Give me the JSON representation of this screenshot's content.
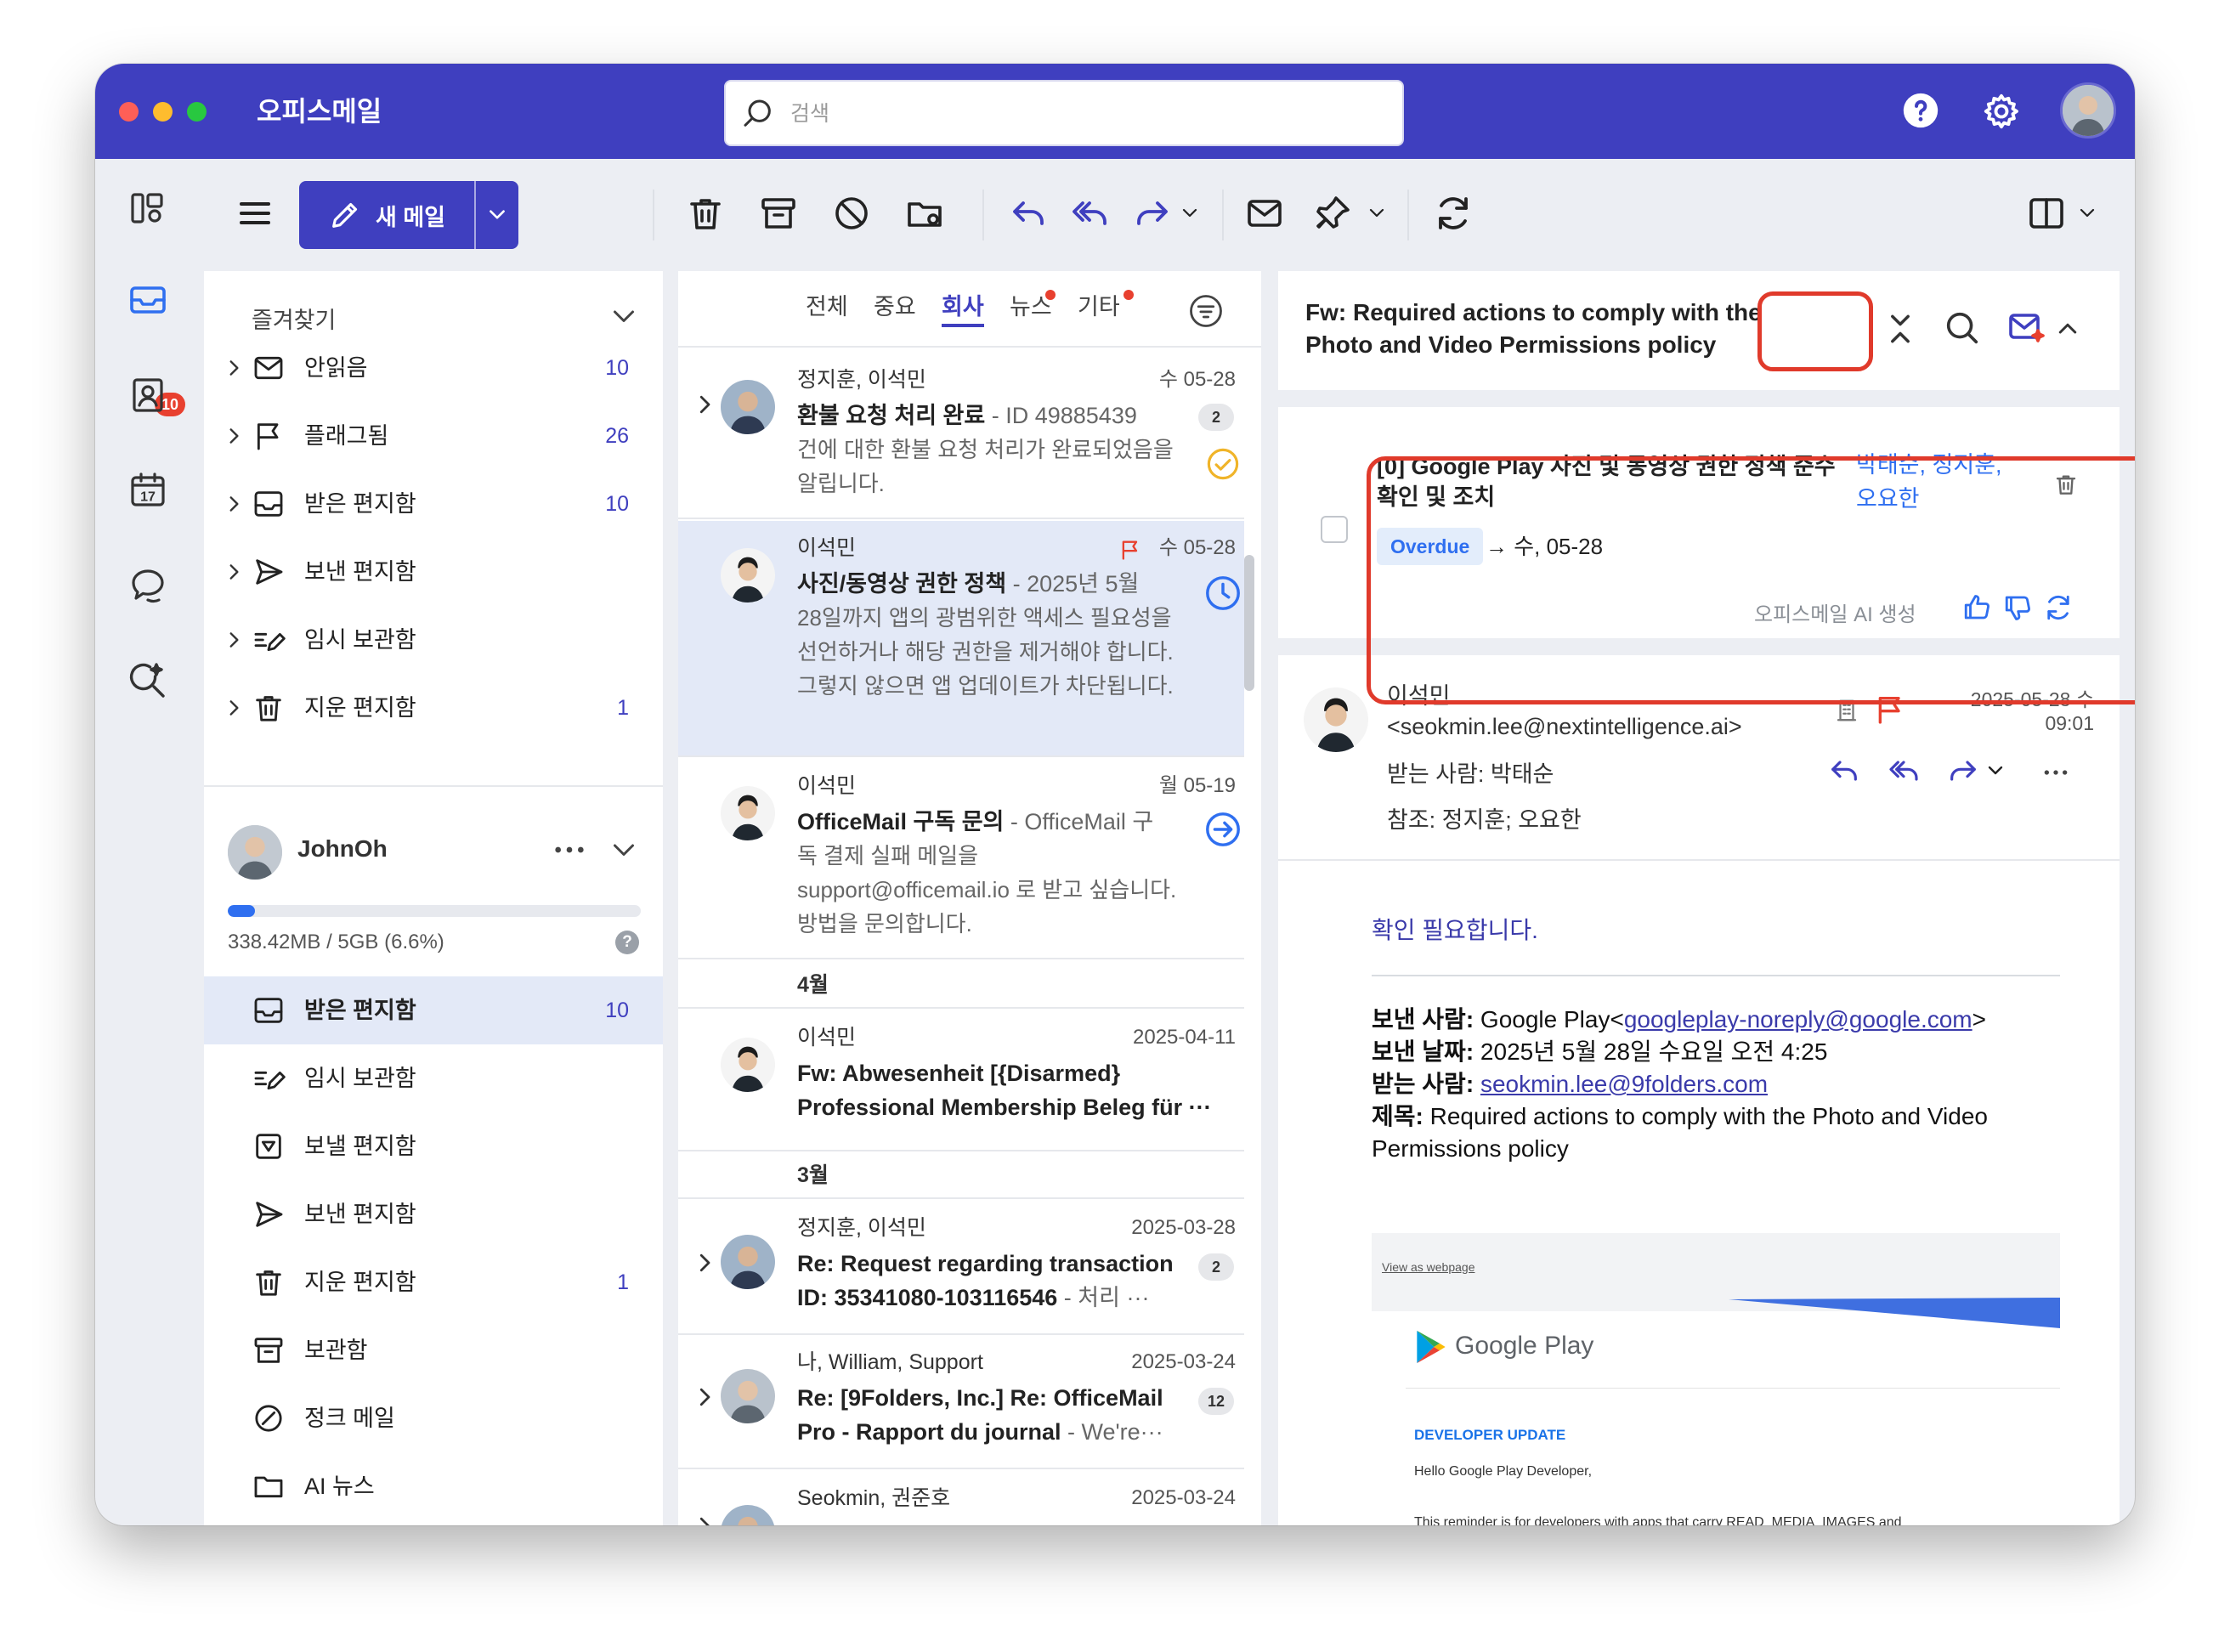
{
  "window": {
    "title": "오피스메일"
  },
  "search": {
    "placeholder": "검색"
  },
  "rail": {
    "mail_badge": "10"
  },
  "toolbar": {
    "new_mail_label": "새 메일"
  },
  "favorites": {
    "title": "즐겨찾기",
    "items": [
      {
        "label": "안읽음",
        "count": "10"
      },
      {
        "label": "플래그됨",
        "count": "26"
      },
      {
        "label": "받은 편지함",
        "count": "10"
      },
      {
        "label": "보낸 편지함",
        "count": ""
      },
      {
        "label": "임시 보관함",
        "count": ""
      },
      {
        "label": "지운 편지함",
        "count": "1"
      }
    ]
  },
  "account": {
    "name": "JohnOh",
    "storage_text": "338.42MB / 5GB (6.6%)",
    "storage_fraction": 0.066,
    "help": "?",
    "folders": [
      {
        "label": "받은 편지함",
        "count": "10"
      },
      {
        "label": "임시 보관함",
        "count": ""
      },
      {
        "label": "보낼 편지함",
        "count": ""
      },
      {
        "label": "보낸 편지함",
        "count": ""
      },
      {
        "label": "지운 편지함",
        "count": "1"
      },
      {
        "label": "보관함",
        "count": ""
      },
      {
        "label": "정크 메일",
        "count": ""
      },
      {
        "label": "AI 뉴스",
        "count": ""
      }
    ]
  },
  "filter_tabs": [
    "전체",
    "중요",
    "회사",
    "뉴스",
    "기타"
  ],
  "messages": [
    {
      "sender": "정지훈, 이석민",
      "date": "수 05-28",
      "subject": "환불 요청 처리 완료",
      "preview_inline": " - ID 49885439",
      "preview": "건에 대한 환불 요청 처리가 완료되었음을 알립니다.",
      "count": "2"
    },
    {
      "sender": "이석민",
      "date": "수 05-28",
      "subject": "사진/동영상 권한 정책",
      "preview_inline": " - 2025년 5월",
      "preview": "28일까지 앱의 광범위한 액세스 필요성을 선언하거나 해당 권한을 제거해야 합니다. 그렇지 않으면 앱 업데이트가 차단됩니다."
    },
    {
      "sender": "이석민",
      "date": "월 05-19",
      "subject": "OfficeMail 구독 문의",
      "preview_inline": " - OfficeMail 구",
      "preview": "독 결제 실패 메일을 support@officemail.io 로 받고 싶습니다. 방법을 문의합니다."
    },
    {
      "sender": "이석민",
      "date": "2025-04-11",
      "subject": "Fw: Abwesenheit [{Disarmed} Professional Membership Beleg für ···"
    },
    {
      "sender": "정지훈, 이석민",
      "date": "2025-03-28",
      "subject": "Re: Request regarding transaction ID: 35341080-103116546",
      "preview_inline": " - 처리 ···",
      "count": "2"
    },
    {
      "sender": "나, William, Support",
      "date": "2025-03-24",
      "subject": "Re: [9Folders, Inc.] Re: OfficeMail Pro - Rapport du journal",
      "preview_inline": " - We're···",
      "count": "12"
    },
    {
      "sender": "Seokmin, 권준호",
      "date": "2025-03-24"
    }
  ],
  "groups": {
    "april": "4월",
    "march": "3월"
  },
  "reader": {
    "subject": "Fw: Required actions to comply with the Photo and Video Permissions policy",
    "ai_task": "[0] Google Play 사진 및 동영상 권한 정책 준수 확인 및 조치",
    "ai_people": "박태순, 정지훈, 오요한",
    "overdue": "Overdue",
    "due": "→ 수, 05-28",
    "ai_generated": "오피스메일 AI 생성",
    "from_name": "이석민",
    "from_email": "<seokmin.lee@nextintelligence.ai>",
    "date_line1": "2025-05-28 수",
    "date_line2": "09:01",
    "to": "받는 사람: 박태순",
    "cc": "참조: 정지훈;  오요한",
    "greeting": "확인 필요합니다.",
    "fwd_from_label": "보낸 사람:",
    "fwd_from_text": " Google Play<",
    "fwd_from_email": "googleplay-noreply@google.com",
    "fwd_from_close": ">",
    "fwd_date_label": "보낸 날짜:",
    "fwd_date": " 2025년 5월 28일 수요일 오전 4:25",
    "fwd_to_label": "받는 사람:",
    "fwd_to_email": "seokmin.lee@9folders.com",
    "fwd_subject_label": "제목:",
    "fwd_subject": " Required actions to comply with the Photo and Video Permissions policy",
    "gp_view": "View as webpage",
    "gp_name": "Google Play",
    "gp_dev": "DEVELOPER UPDATE",
    "gp_hello": "Hello Google Play Developer,",
    "gp_remind": "This reminder is for developers with apps that carry READ_MEDIA_IMAGES and READ_MEDIA_VIDEO permissions"
  },
  "colors": {
    "brand": "#3f3fbf",
    "highlight": "#e03a2b",
    "link": "#2f6ff0",
    "badge": "#e8402f"
  },
  "icons": [
    "search-icon",
    "help-icon",
    "settings-icon",
    "apps-icon",
    "mail-icon",
    "contacts-icon",
    "calendar-icon",
    "chat-icon",
    "ai-search-icon",
    "menu-icon",
    "pencil-icon",
    "trash-icon",
    "archive-icon",
    "block-icon",
    "move-folder-icon",
    "reply-icon",
    "reply-all-icon",
    "forward-icon",
    "envelope-icon",
    "pin-icon",
    "refresh-icon",
    "layout-icon",
    "filter-icon",
    "flag-icon",
    "clock-icon",
    "check-circle-icon",
    "arrow-circle-icon",
    "collapse-icon",
    "ai-mail-icon",
    "thumbs-up-icon",
    "thumbs-down-icon",
    "building-icon",
    "more-icon"
  ]
}
